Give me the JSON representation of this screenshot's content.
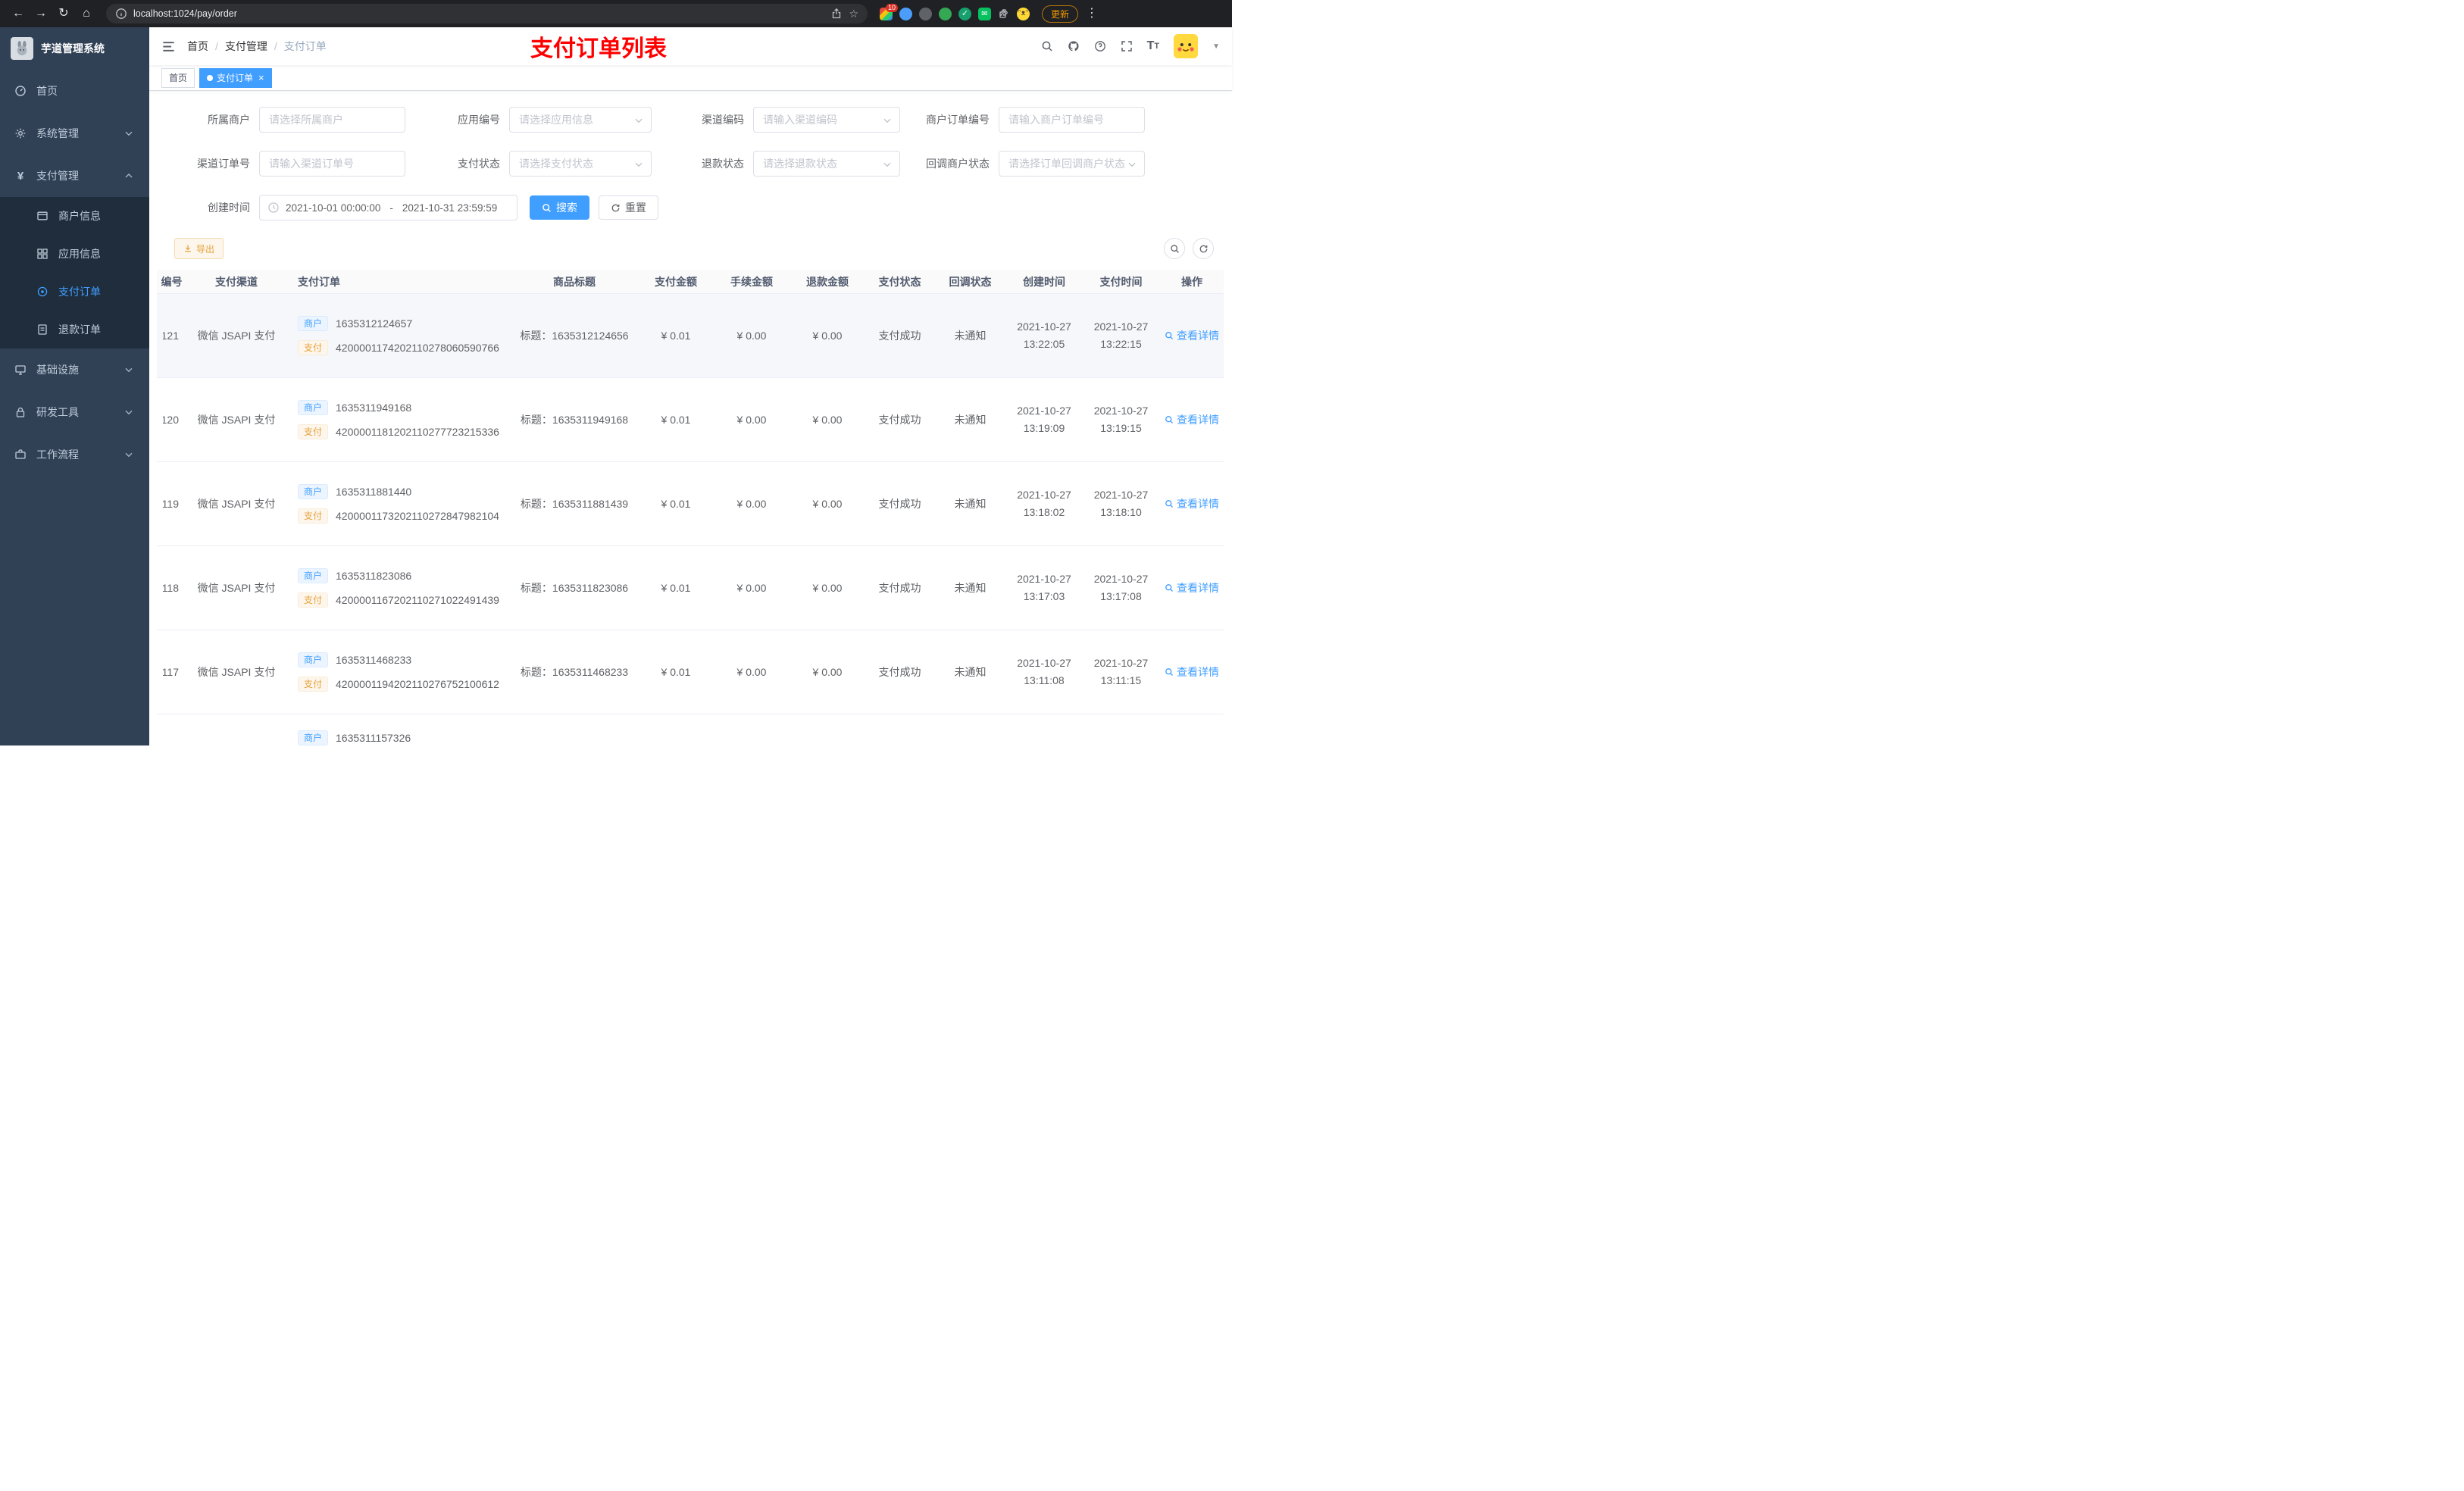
{
  "browser": {
    "url": "localhost:1024/pay/order",
    "update_label": "更新",
    "extension_badge": "10"
  },
  "colors": {
    "primary": "#409eff",
    "annotation_red": "#fe0000",
    "warning": "#e6a23c",
    "sidebar_bg": "#304156",
    "sidebar_sub_bg": "#1f2d3d"
  },
  "sidebar": {
    "logo_title": "芋道管理系统",
    "home": "首页",
    "system": "系统管理",
    "payment": "支付管理",
    "merchant_info": "商户信息",
    "app_info": "应用信息",
    "pay_order": "支付订单",
    "refund_order": "退款订单",
    "infra": "基础设施",
    "dev_tools": "研发工具",
    "workflow": "工作流程"
  },
  "breadcrumb": {
    "items": [
      "首页",
      "支付管理",
      "支付订单"
    ]
  },
  "annotation_title": "支付订单列表",
  "tabs": {
    "home": "首页",
    "active": "支付订单"
  },
  "filters": {
    "merchant": {
      "label": "所属商户",
      "placeholder": "请选择所属商户"
    },
    "app_no": {
      "label": "应用编号",
      "placeholder": "请选择应用信息"
    },
    "channel_code": {
      "label": "渠道编码",
      "placeholder": "请输入渠道编码"
    },
    "merchant_order_no": {
      "label": "商户订单编号",
      "placeholder": "请输入商户订单编号"
    },
    "channel_order_no": {
      "label": "渠道订单号",
      "placeholder": "请输入渠道订单号"
    },
    "pay_status": {
      "label": "支付状态",
      "placeholder": "请选择支付状态"
    },
    "refund_status": {
      "label": "退款状态",
      "placeholder": "请选择退款状态"
    },
    "notify_status": {
      "label": "回调商户状态",
      "placeholder": "请选择订单回调商户状态"
    },
    "create_time": {
      "label": "创建时间",
      "start": "2021-10-01 00:00:00",
      "separator": "-",
      "end": "2021-10-31 23:59:59"
    },
    "search_label": "搜索",
    "reset_label": "重置"
  },
  "toolbar": {
    "export_label": "导出"
  },
  "table": {
    "headers": [
      "编号",
      "支付渠道",
      "支付订单",
      "商品标题",
      "支付金额",
      "手续金额",
      "退款金额",
      "支付状态",
      "回调状态",
      "创建时间",
      "支付时间",
      "操作"
    ],
    "tag_merchant": "商户",
    "tag_pay": "支付",
    "action_label": "查看详情",
    "rows": [
      {
        "id": "121",
        "channel": "微信 JSAPI 支付",
        "merchant_no": "1635312124657",
        "pay_no": "4200001174202110278060590766",
        "title": "标题：1635312124656",
        "amount": "¥ 0.01",
        "fee": "¥ 0.00",
        "refund": "¥ 0.00",
        "status": "支付成功",
        "notify": "未通知",
        "create_date": "2021-10-27",
        "create_time": "13:22:05",
        "pay_date": "2021-10-27",
        "pay_time": "13:22:15"
      },
      {
        "id": "120",
        "channel": "微信 JSAPI 支付",
        "merchant_no": "1635311949168",
        "pay_no": "4200001181202110277723215336",
        "title": "标题：1635311949168",
        "amount": "¥ 0.01",
        "fee": "¥ 0.00",
        "refund": "¥ 0.00",
        "status": "支付成功",
        "notify": "未通知",
        "create_date": "2021-10-27",
        "create_time": "13:19:09",
        "pay_date": "2021-10-27",
        "pay_time": "13:19:15"
      },
      {
        "id": "119",
        "channel": "微信 JSAPI 支付",
        "merchant_no": "1635311881440",
        "pay_no": "4200001173202110272847982104",
        "title": "标题：1635311881439",
        "amount": "¥ 0.01",
        "fee": "¥ 0.00",
        "refund": "¥ 0.00",
        "status": "支付成功",
        "notify": "未通知",
        "create_date": "2021-10-27",
        "create_time": "13:18:02",
        "pay_date": "2021-10-27",
        "pay_time": "13:18:10"
      },
      {
        "id": "118",
        "channel": "微信 JSAPI 支付",
        "merchant_no": "1635311823086",
        "pay_no": "4200001167202110271022491439",
        "title": "标题：1635311823086",
        "amount": "¥ 0.01",
        "fee": "¥ 0.00",
        "refund": "¥ 0.00",
        "status": "支付成功",
        "notify": "未通知",
        "create_date": "2021-10-27",
        "create_time": "13:17:03",
        "pay_date": "2021-10-27",
        "pay_time": "13:17:08"
      },
      {
        "id": "117",
        "channel": "微信 JSAPI 支付",
        "merchant_no": "1635311468233",
        "pay_no": "4200001194202110276752100612",
        "title": "标题：1635311468233",
        "amount": "¥ 0.01",
        "fee": "¥ 0.00",
        "refund": "¥ 0.00",
        "status": "支付成功",
        "notify": "未通知",
        "create_date": "2021-10-27",
        "create_time": "13:11:08",
        "pay_date": "2021-10-27",
        "pay_time": "13:11:15"
      },
      {
        "id": "",
        "channel": "",
        "merchant_no": "1635311157326",
        "pay_no": "",
        "title": "",
        "amount": "",
        "fee": "",
        "refund": "",
        "status": "",
        "notify": "",
        "create_date": "",
        "create_time": "",
        "pay_date": "",
        "pay_time": ""
      }
    ]
  }
}
